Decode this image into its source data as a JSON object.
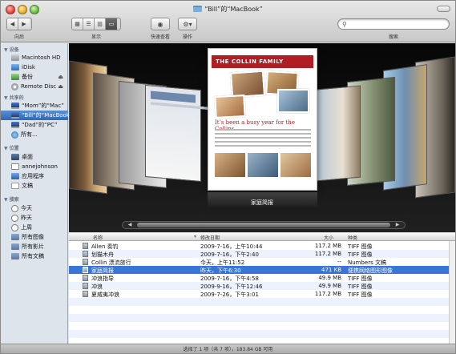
{
  "window": {
    "title": "“Bill”的“MacBook”"
  },
  "toolbar": {
    "back_forward_label": "向后",
    "view_label": "显示",
    "quicklook_label": "快速查看",
    "action_label": "操作",
    "search_label": "搜索",
    "view_buttons": [
      "grid",
      "list",
      "columns",
      "coverflow"
    ],
    "active_view": "coverflow"
  },
  "search": {
    "value": "",
    "placeholder": ""
  },
  "sidebar": {
    "sections": [
      {
        "title": "设备",
        "items": [
          {
            "label": "Macintosh HD",
            "icon": "hard-drive-icon"
          },
          {
            "label": "iDisk",
            "icon": "idisk-icon"
          },
          {
            "label": "备份",
            "icon": "backup-drive-icon",
            "eject": true
          },
          {
            "label": "Remote Disc",
            "icon": "disc-icon",
            "eject": true
          }
        ]
      },
      {
        "title": "共享的",
        "items": [
          {
            "label": "“Mom”的“Mac”",
            "icon": "computer-icon"
          },
          {
            "label": "“Bill”的“MacBook”",
            "icon": "laptop-icon",
            "selected": true
          },
          {
            "label": "“Dad”的“PC”",
            "icon": "pc-icon"
          },
          {
            "label": "所有...",
            "icon": "network-icon"
          }
        ]
      },
      {
        "title": "位置",
        "items": [
          {
            "label": "桌面",
            "icon": "desktop-icon"
          },
          {
            "label": "annejohnson",
            "icon": "home-icon"
          },
          {
            "label": "应用程序",
            "icon": "applications-icon"
          },
          {
            "label": "文稿",
            "icon": "documents-icon"
          }
        ]
      },
      {
        "title": "搜索",
        "items": [
          {
            "label": "今天",
            "icon": "clock-icon"
          },
          {
            "label": "昨天",
            "icon": "clock-icon"
          },
          {
            "label": "上周",
            "icon": "clock-icon"
          },
          {
            "label": "所有图像",
            "icon": "smart-folder-icon"
          },
          {
            "label": "所有影片",
            "icon": "smart-folder-icon"
          },
          {
            "label": "所有文稿",
            "icon": "smart-folder-icon"
          }
        ]
      }
    ]
  },
  "coverflow": {
    "caption": "家庭简报",
    "center_doc": {
      "banner": "THE COLLIN FAMILY",
      "headline": "It’s been a busy year for the Collins."
    }
  },
  "list": {
    "columns": {
      "name": "名称",
      "date": "修改日期",
      "size": "大小",
      "kind": "种类"
    },
    "rows": [
      {
        "name": "Allen 奏钓",
        "date": "2009-7-16，上午10:44",
        "size": "117.2 MB",
        "kind": "TIFF 图像"
      },
      {
        "name": "划猫木舟",
        "date": "2009-7-16，下午2:40",
        "size": "117.2 MB",
        "kind": "TIFF 图像"
      },
      {
        "name": "Collin 漂流旅行",
        "date": "今天，上午11:52",
        "size": "--",
        "kind": "Numbers 文稿"
      },
      {
        "name": "家庭简报",
        "date": "昨天，下午6:30",
        "size": "471 KB",
        "kind": "便携网络图形图像",
        "selected": true
      },
      {
        "name": "冲浪指导",
        "date": "2009-7-16，下午4:58",
        "size": "49.9 MB",
        "kind": "TIFF 图像"
      },
      {
        "name": "冲浪",
        "date": "2009-9-16，下午12:46",
        "size": "49.9 MB",
        "kind": "TIFF 图像"
      },
      {
        "name": "夏威夷冲浪",
        "date": "2009-7-26，下午3:01",
        "size": "117.2 MB",
        "kind": "TIFF 图像"
      }
    ]
  },
  "statusbar": {
    "text": "选择了 1 项（共 7 项），183.84 GB 可用"
  }
}
